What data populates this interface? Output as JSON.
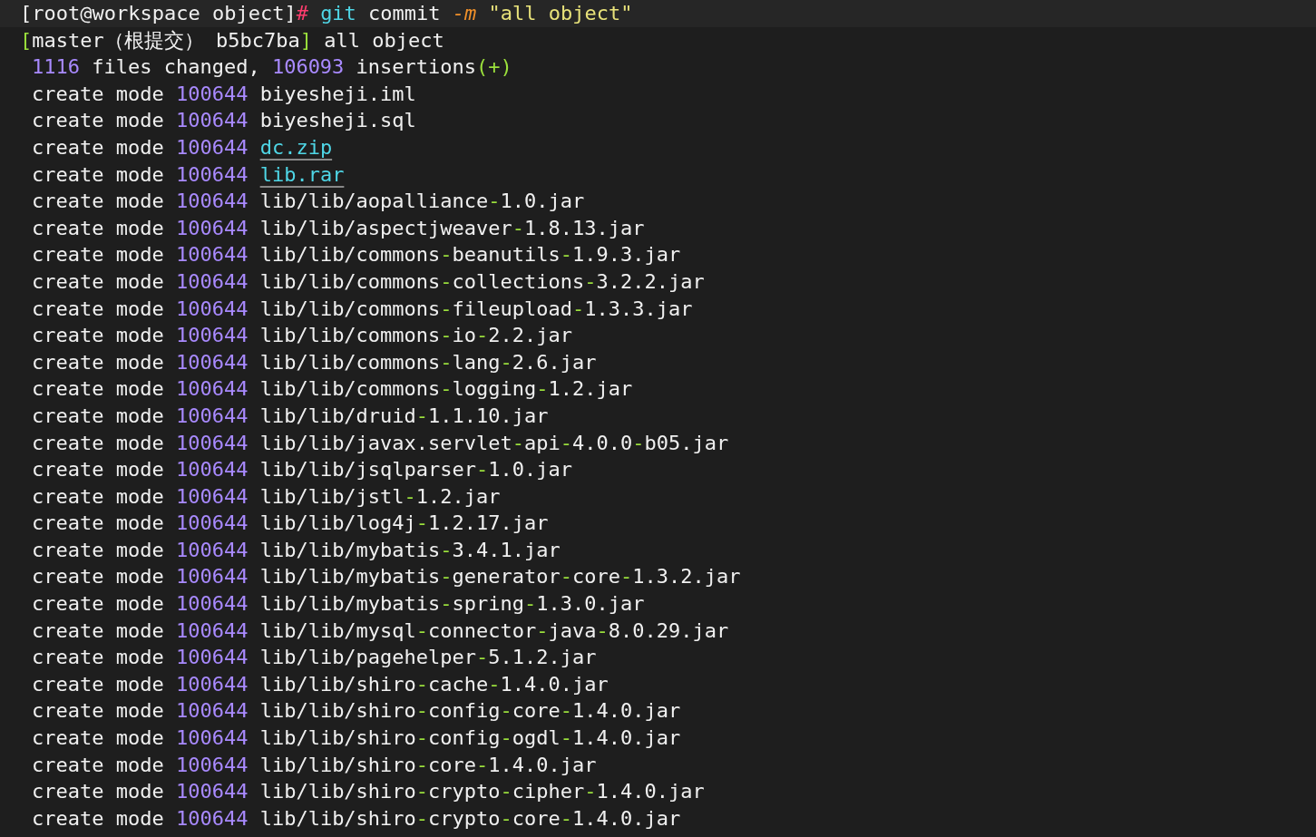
{
  "prompt": {
    "user_host": "[root@workspace object]",
    "symbol": "#",
    "command": "git",
    "subcommand": "commit",
    "flag": "-m",
    "message": "\"all object\""
  },
  "commit_line": {
    "open_bracket": "[",
    "ref": "master（根提交） b5bc7ba",
    "close_bracket": "]",
    "message": "all object"
  },
  "summary": {
    "files_count": "1116",
    "files_label": "files changed,",
    "insertions_count": "106093",
    "insertions_label": "insertions",
    "insertions_sign": "(+)"
  },
  "files": [
    {
      "action": "create mode",
      "mode": "100644",
      "path": "biyesheji.iml",
      "kind": "plain"
    },
    {
      "action": "create mode",
      "mode": "100644",
      "path": "biyesheji.sql",
      "kind": "plain"
    },
    {
      "action": "create mode",
      "mode": "100644",
      "path": "dc.zip",
      "kind": "link"
    },
    {
      "action": "create mode",
      "mode": "100644",
      "path": "lib.rar",
      "kind": "link"
    },
    {
      "action": "create mode",
      "mode": "100644",
      "path": "lib/lib/aopalliance-1.0.jar",
      "kind": "plain"
    },
    {
      "action": "create mode",
      "mode": "100644",
      "path": "lib/lib/aspectjweaver-1.8.13.jar",
      "kind": "plain"
    },
    {
      "action": "create mode",
      "mode": "100644",
      "path": "lib/lib/commons-beanutils-1.9.3.jar",
      "kind": "plain"
    },
    {
      "action": "create mode",
      "mode": "100644",
      "path": "lib/lib/commons-collections-3.2.2.jar",
      "kind": "plain"
    },
    {
      "action": "create mode",
      "mode": "100644",
      "path": "lib/lib/commons-fileupload-1.3.3.jar",
      "kind": "plain"
    },
    {
      "action": "create mode",
      "mode": "100644",
      "path": "lib/lib/commons-io-2.2.jar",
      "kind": "plain"
    },
    {
      "action": "create mode",
      "mode": "100644",
      "path": "lib/lib/commons-lang-2.6.jar",
      "kind": "plain"
    },
    {
      "action": "create mode",
      "mode": "100644",
      "path": "lib/lib/commons-logging-1.2.jar",
      "kind": "plain"
    },
    {
      "action": "create mode",
      "mode": "100644",
      "path": "lib/lib/druid-1.1.10.jar",
      "kind": "plain"
    },
    {
      "action": "create mode",
      "mode": "100644",
      "path": "lib/lib/javax.servlet-api-4.0.0-b05.jar",
      "kind": "plain"
    },
    {
      "action": "create mode",
      "mode": "100644",
      "path": "lib/lib/jsqlparser-1.0.jar",
      "kind": "plain"
    },
    {
      "action": "create mode",
      "mode": "100644",
      "path": "lib/lib/jstl-1.2.jar",
      "kind": "plain"
    },
    {
      "action": "create mode",
      "mode": "100644",
      "path": "lib/lib/log4j-1.2.17.jar",
      "kind": "plain"
    },
    {
      "action": "create mode",
      "mode": "100644",
      "path": "lib/lib/mybatis-3.4.1.jar",
      "kind": "plain"
    },
    {
      "action": "create mode",
      "mode": "100644",
      "path": "lib/lib/mybatis-generator-core-1.3.2.jar",
      "kind": "plain"
    },
    {
      "action": "create mode",
      "mode": "100644",
      "path": "lib/lib/mybatis-spring-1.3.0.jar",
      "kind": "plain"
    },
    {
      "action": "create mode",
      "mode": "100644",
      "path": "lib/lib/mysql-connector-java-8.0.29.jar",
      "kind": "plain"
    },
    {
      "action": "create mode",
      "mode": "100644",
      "path": "lib/lib/pagehelper-5.1.2.jar",
      "kind": "plain"
    },
    {
      "action": "create mode",
      "mode": "100644",
      "path": "lib/lib/shiro-cache-1.4.0.jar",
      "kind": "plain"
    },
    {
      "action": "create mode",
      "mode": "100644",
      "path": "lib/lib/shiro-config-core-1.4.0.jar",
      "kind": "plain"
    },
    {
      "action": "create mode",
      "mode": "100644",
      "path": "lib/lib/shiro-config-ogdl-1.4.0.jar",
      "kind": "plain"
    },
    {
      "action": "create mode",
      "mode": "100644",
      "path": "lib/lib/shiro-core-1.4.0.jar",
      "kind": "plain"
    },
    {
      "action": "create mode",
      "mode": "100644",
      "path": "lib/lib/shiro-crypto-cipher-1.4.0.jar",
      "kind": "plain"
    },
    {
      "action": "create mode",
      "mode": "100644",
      "path": "lib/lib/shiro-crypto-core-1.4.0.jar",
      "kind": "plain"
    }
  ]
}
